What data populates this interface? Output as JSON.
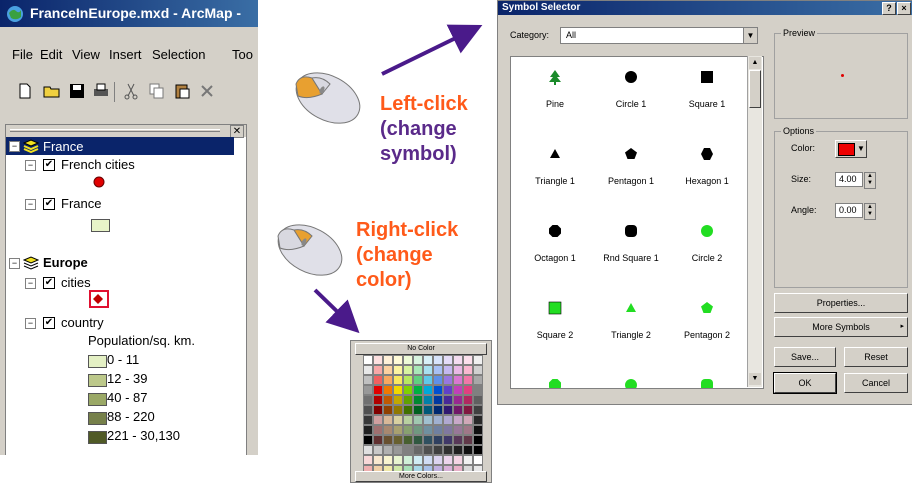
{
  "arcmap": {
    "title": "FranceInEurope.mxd - ArcMap - ",
    "menu": [
      "File",
      "Edit",
      "View",
      "Insert",
      "Selection",
      "Too"
    ],
    "toc": {
      "groups": [
        {
          "name": "France",
          "layers": [
            {
              "name": "French cities"
            },
            {
              "name": "France"
            }
          ]
        },
        {
          "name": "Europe",
          "layers": [
            {
              "name": "cities"
            },
            {
              "name": "country",
              "legend_title": "Population/sq. km.",
              "classes": [
                "0 - 11",
                "12 - 39",
                "40 - 87",
                "88 - 220",
                "221 - 30,130"
              ],
              "colors": [
                "#e4f0c4",
                "#bcc88a",
                "#9aa866",
                "#76804a",
                "#505a26"
              ]
            }
          ]
        }
      ]
    }
  },
  "annotations": {
    "left_click": [
      "Left-click",
      "(change",
      "symbol)"
    ],
    "right_click": [
      "Right-click",
      "(change",
      "color)"
    ],
    "left_color": "#5a2a8a",
    "right_color": "#ff5a1a"
  },
  "symbol_selector": {
    "title": "Symbol Selector",
    "title_buttons": [
      "?",
      "×"
    ],
    "category_label": "Category:",
    "category_value": "All",
    "preview_label": "Preview",
    "options_label": "Options",
    "color_label": "Color:",
    "size_label": "Size:",
    "size_value": "4.00",
    "angle_label": "Angle:",
    "angle_value": "0.00",
    "buttons": {
      "properties": "Properties...",
      "more_symbols": "More Symbols",
      "save": "Save...",
      "reset": "Reset",
      "ok": "OK",
      "cancel": "Cancel"
    },
    "symbols": [
      {
        "label": "Pine",
        "icon": "pine-tree-icon",
        "color": "#1a8a2a"
      },
      {
        "label": "Circle 1",
        "icon": "circle-icon",
        "color": "#000000"
      },
      {
        "label": "Square 1",
        "icon": "square-icon",
        "color": "#000000"
      },
      {
        "label": "Triangle 1",
        "icon": "triangle-icon",
        "color": "#000000"
      },
      {
        "label": "Pentagon 1",
        "icon": "pentagon-icon",
        "color": "#000000"
      },
      {
        "label": "Hexagon 1",
        "icon": "hexagon-icon",
        "color": "#000000"
      },
      {
        "label": "Octagon 1",
        "icon": "octagon-icon",
        "color": "#000000"
      },
      {
        "label": "Rnd Square 1",
        "icon": "rounded-square-icon",
        "color": "#000000"
      },
      {
        "label": "Circle 2",
        "icon": "circle-icon",
        "color": "#22dd22"
      },
      {
        "label": "Square 2",
        "icon": "square-icon",
        "color": "#22dd22"
      },
      {
        "label": "Triangle 2",
        "icon": "triangle-icon",
        "color": "#22dd22"
      },
      {
        "label": "Pentagon 2",
        "icon": "pentagon-icon",
        "color": "#22dd22"
      },
      {
        "label": "",
        "icon": "octagon-icon",
        "color": "#22dd22"
      },
      {
        "label": "",
        "icon": "circle-icon",
        "color": "#22dd22"
      },
      {
        "label": "",
        "icon": "rounded-square-icon",
        "color": "#22dd22"
      }
    ]
  },
  "palette": {
    "no_color": "No Color",
    "more_colors": "More Colors..."
  }
}
